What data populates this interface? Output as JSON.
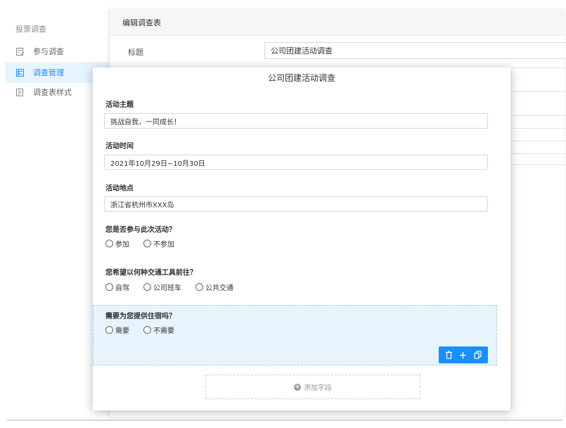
{
  "sidebar": {
    "title": "投票调查",
    "items": [
      {
        "label": "参与调查"
      },
      {
        "label": "调查管理"
      },
      {
        "label": "调查表样式"
      }
    ]
  },
  "editor": {
    "header": "编辑调查表",
    "title_label": "标题",
    "title_value": "公司团建活动调查"
  },
  "form": {
    "title": "公司团建活动调查",
    "fields": [
      {
        "label": "活动主题",
        "value": "挑战自我，一同成长！"
      },
      {
        "label": "活动时间",
        "value": "2021年10月29日~10月30日"
      },
      {
        "label": "活动地点",
        "value": "浙江省杭州市XXX岛"
      }
    ],
    "questions": [
      {
        "label": "您是否参与此次活动？",
        "options": [
          "参加",
          "不参加"
        ]
      },
      {
        "label": "您希望以何种交通工具前往？",
        "options": [
          "自驾",
          "公司班车",
          "公共交通"
        ]
      },
      {
        "label": "需要为您提供住宿吗？",
        "options": [
          "需要",
          "不需要"
        ]
      }
    ],
    "add_field_label": "添加字段"
  },
  "colors": {
    "accent": "#1890ff",
    "selected_bg": "#e7f4fd"
  }
}
